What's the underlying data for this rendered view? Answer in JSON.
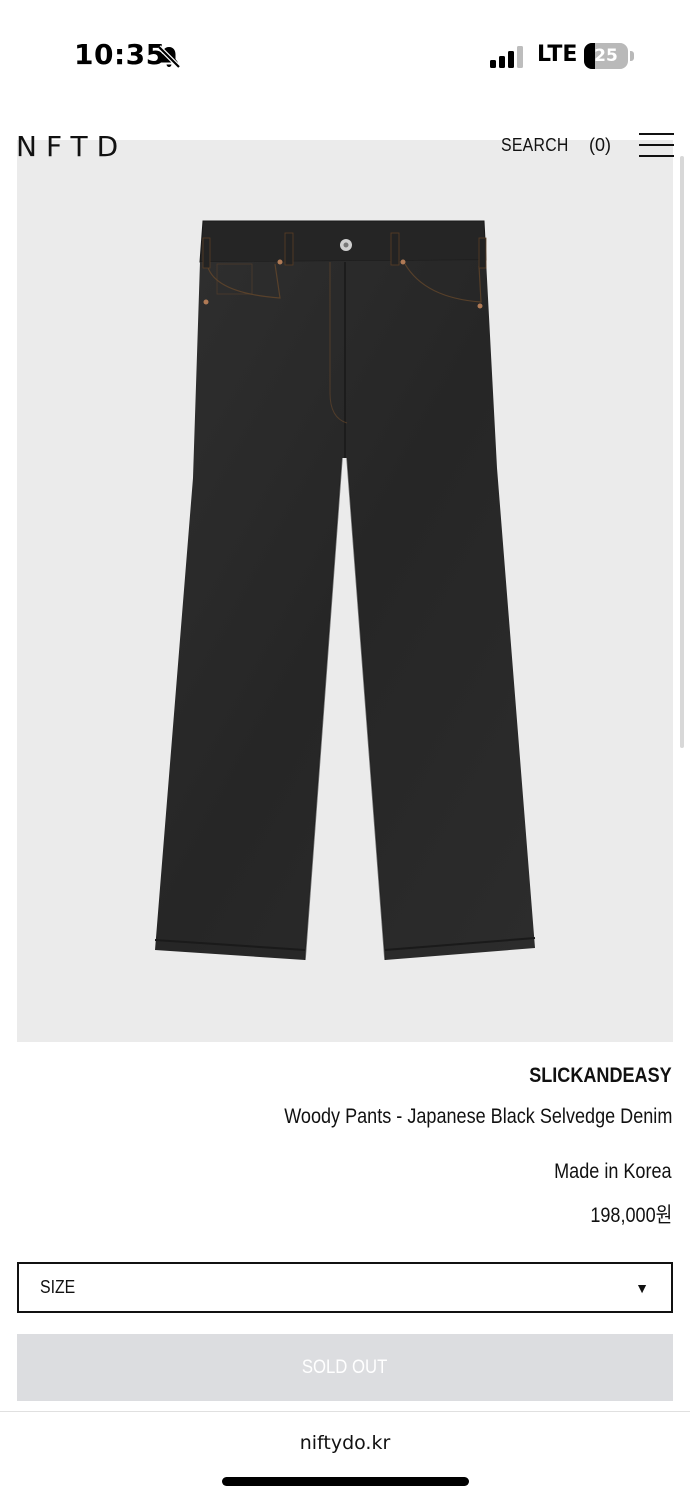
{
  "status_bar": {
    "time": "10:35",
    "network": "LTE",
    "battery_level": "25",
    "battery_fraction": 0.25,
    "icons": [
      "bell-slash-icon",
      "signal-icon",
      "battery-icon"
    ]
  },
  "header": {
    "logo": "NFTD",
    "search_label": "SEARCH",
    "cart_label": "(0)",
    "menu_icon": "hamburger-menu-icon"
  },
  "product": {
    "image_description_icon": "jeans-image",
    "brand": "SLICKANDEASY",
    "name": "Woody Pants - Japanese Black Selvedge Denim",
    "origin": "Made in Korea",
    "price": "198,000원"
  },
  "size_select": {
    "label": "SIZE",
    "caret": "▼"
  },
  "purchase": {
    "sold_out_label": "SOLD OUT"
  },
  "browser": {
    "url": "niftydo.kr"
  },
  "colors": {
    "image_background": "#ebebeb",
    "denim": "#2a2a2a",
    "sold_out_bg": "#dcdde0"
  }
}
